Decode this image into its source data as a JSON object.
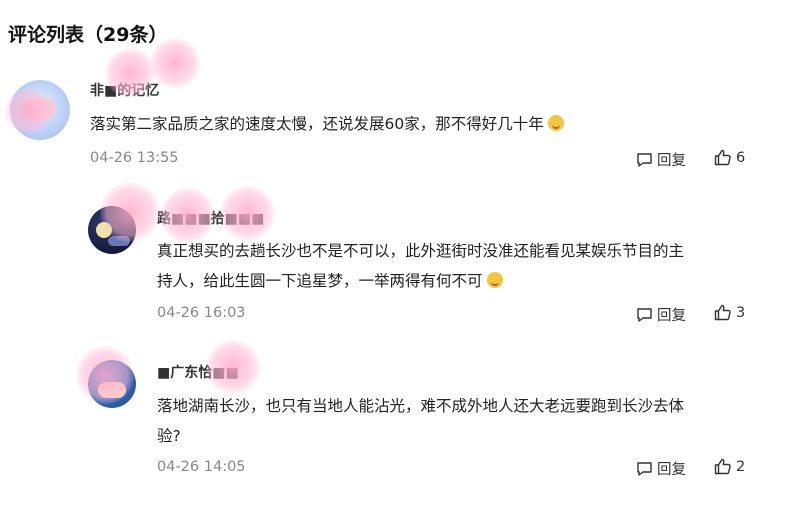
{
  "header": {
    "title": "评论列表（29条）"
  },
  "comments": [
    {
      "username": "非■的记忆",
      "text": "落实第二家品质之家的速度太慢，还说发展60家，那不得好几十年",
      "time": "04-26 13:55",
      "reply_label": "回复",
      "likes": "6",
      "emoji": "grinning-sweat"
    },
    {
      "username": "路■■■拾■■■",
      "text_line1": "真正想买的去趟长沙也不是不可以，此外逛街时没准还能看见某娱乐节目的主",
      "text_line2": "持人，给此生圆一下追星梦，一举两得有何不可",
      "time": "04-26 16:03",
      "reply_label": "回复",
      "likes": "3",
      "emoji": "smiling"
    },
    {
      "username": "■广东恰■■",
      "text_line1": "落地湖南长沙，也只有当地人能沾光，难不成外地人还大老远要跑到长沙去体",
      "text_line2": "验?",
      "time": "04-26 14:05",
      "reply_label": "回复",
      "likes": "2"
    }
  ],
  "icons": {
    "reply": "comment-bubble-icon",
    "like": "thumbs-up-icon"
  }
}
